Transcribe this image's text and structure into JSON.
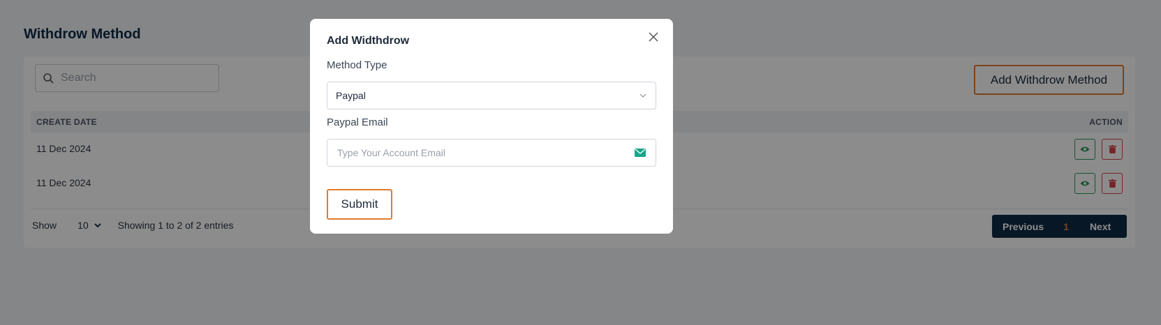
{
  "page": {
    "title": "Withdrow Method"
  },
  "toolbar": {
    "search_placeholder": "Search",
    "add_button_label": "Add Withdrow Method"
  },
  "table": {
    "headers": [
      "CREATE DATE",
      "ACTION"
    ],
    "rows": [
      {
        "date": "11 Dec 2024"
      },
      {
        "date": "11 Dec 2024"
      }
    ]
  },
  "footer": {
    "show_label": "Show",
    "page_size": "10",
    "entries_text": "Showing 1 to 2 of 2 entries"
  },
  "pagination": {
    "previous_label": "Previous",
    "current_page": "1",
    "next_label": "Next"
  },
  "modal": {
    "title": "Add Widthdrow",
    "method_type_label": "Method Type",
    "method_type_value": "Paypal",
    "email_label": "Paypal Email",
    "email_placeholder": "Type Your Account Email",
    "submit_label": "Submit"
  },
  "colors": {
    "accent": "#e07a2e",
    "navy": "#0d2b45",
    "view_green": "#2b9a5e",
    "delete_red": "#d8434a"
  },
  "icons": [
    "search-icon",
    "eye-icon",
    "trash-icon",
    "chevron-down-icon",
    "close-icon",
    "mail-icon"
  ]
}
